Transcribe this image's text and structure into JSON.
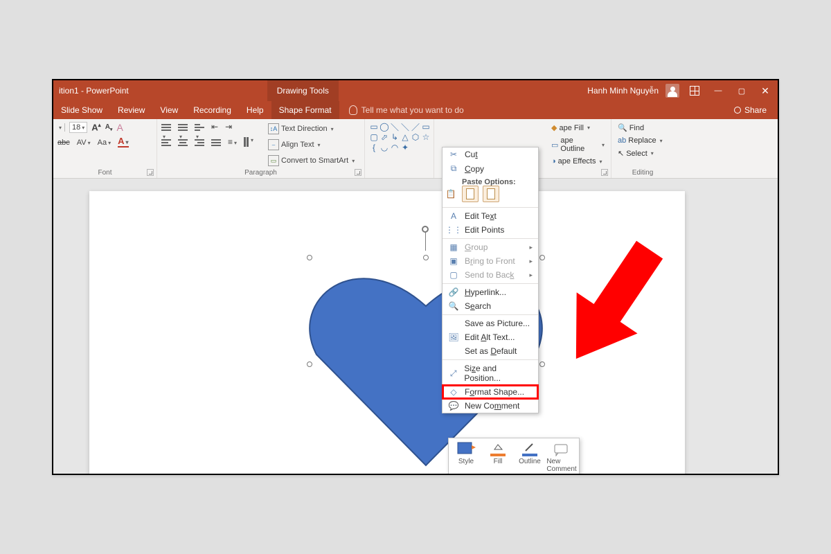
{
  "titlebar": {
    "doc": "ition1 - PowerPoint",
    "tools_tab": "Drawing Tools",
    "username": "Hanh Minh Nguyễn"
  },
  "tabs": {
    "slideshow": "Slide Show",
    "review": "Review",
    "view": "View",
    "recording": "Recording",
    "help": "Help",
    "shapeformat": "Shape Format",
    "tellme": "Tell me what you want to do",
    "share": "Share"
  },
  "ribbon": {
    "font": {
      "label": "Font",
      "size": "18",
      "abc": "abc",
      "av": "AV"
    },
    "paragraph": {
      "label": "Paragraph",
      "textdir": "Text Direction",
      "aligntext": "Align Text",
      "smartart": "Convert to SmartArt"
    },
    "shapestyles": {
      "fill": "ape Fill",
      "outline": "ape Outline",
      "effects": "ape Effects"
    },
    "editing": {
      "label": "Editing",
      "find": "Find",
      "replace": "Replace",
      "select": "Select"
    }
  },
  "context_menu": {
    "cut": "Cut",
    "copy": "Copy",
    "paste_header": "Paste Options:",
    "edit_text": "Edit Text",
    "edit_points": "Edit Points",
    "group": "Group",
    "bring_front": "Bring to Front",
    "send_back": "Send to Back",
    "hyperlink": "Hyperlink...",
    "search": "Search",
    "save_picture": "Save as Picture...",
    "alt_text": "Edit Alt Text...",
    "set_default": "Set as Default",
    "size_pos": "Size and Position...",
    "format_shape": "Format Shape...",
    "new_comment": "New Comment"
  },
  "mini_toolbar": {
    "style": "Style",
    "fill": "Fill",
    "outline": "Outline",
    "comment": "New Comment"
  }
}
